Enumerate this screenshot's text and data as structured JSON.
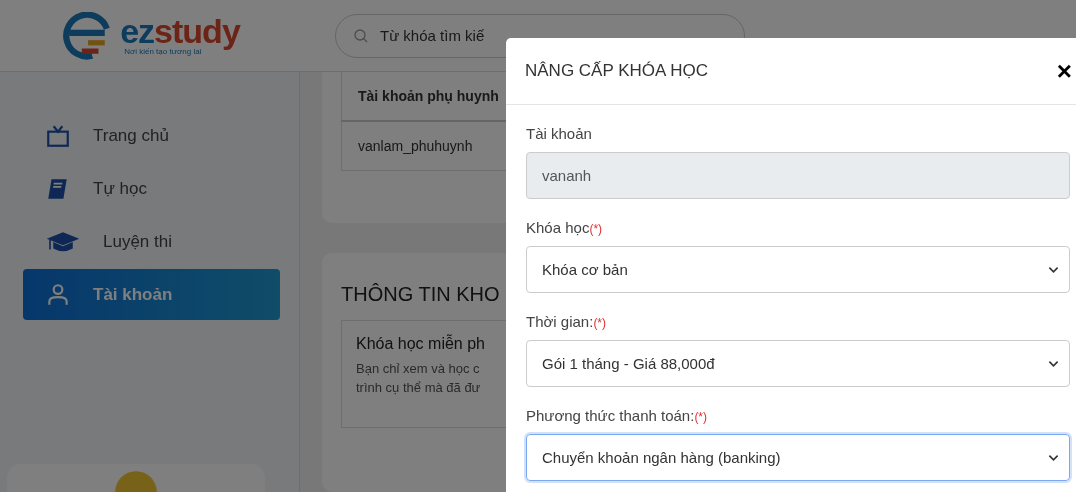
{
  "logo": {
    "name_parts": [
      "ez",
      "study"
    ],
    "tagline": "Nơi kiến tạo tương lai"
  },
  "search": {
    "placeholder": "Từ khóa tìm kiế"
  },
  "sidebar": {
    "items": [
      {
        "label": "Trang chủ",
        "kind": "home",
        "selected": false
      },
      {
        "label": "Tự học",
        "kind": "self-study",
        "selected": false
      },
      {
        "label": "Luyện thi",
        "kind": "exam",
        "selected": false
      },
      {
        "label": "Tài khoản",
        "kind": "account",
        "selected": true
      }
    ]
  },
  "parent_table": {
    "columns": [
      "Tài khoản phụ huynh"
    ],
    "rows": [
      [
        "vanlam_phuhuynh"
      ]
    ]
  },
  "course_info": {
    "heading": "THÔNG TIN KHO",
    "plan": {
      "title": "Khóa học miễn ph",
      "description_lines": [
        "Bạn chỉ xem và học c",
        "trình cụ thể mà đã đư"
      ]
    }
  },
  "modal": {
    "title": "NÂNG CẤP KHÓA HỌC",
    "close": "×",
    "fields": [
      {
        "label": "Tài khoản",
        "kind": "readonly",
        "value": "vananh",
        "focused": false
      },
      {
        "label": "Khóa học",
        "required_mark": "(*)",
        "kind": "select",
        "value": "Khóa cơ bản",
        "focused": false
      },
      {
        "label": "Thời gian:",
        "required_mark": "(*)",
        "kind": "select",
        "value": "Gói 1 tháng - Giá 88,000đ",
        "focused": false
      },
      {
        "label": "Phương thức thanh toán:",
        "required_mark": "(*)",
        "kind": "select",
        "value": "Chuyển khoản ngân hàng (banking)",
        "focused": true
      }
    ]
  }
}
